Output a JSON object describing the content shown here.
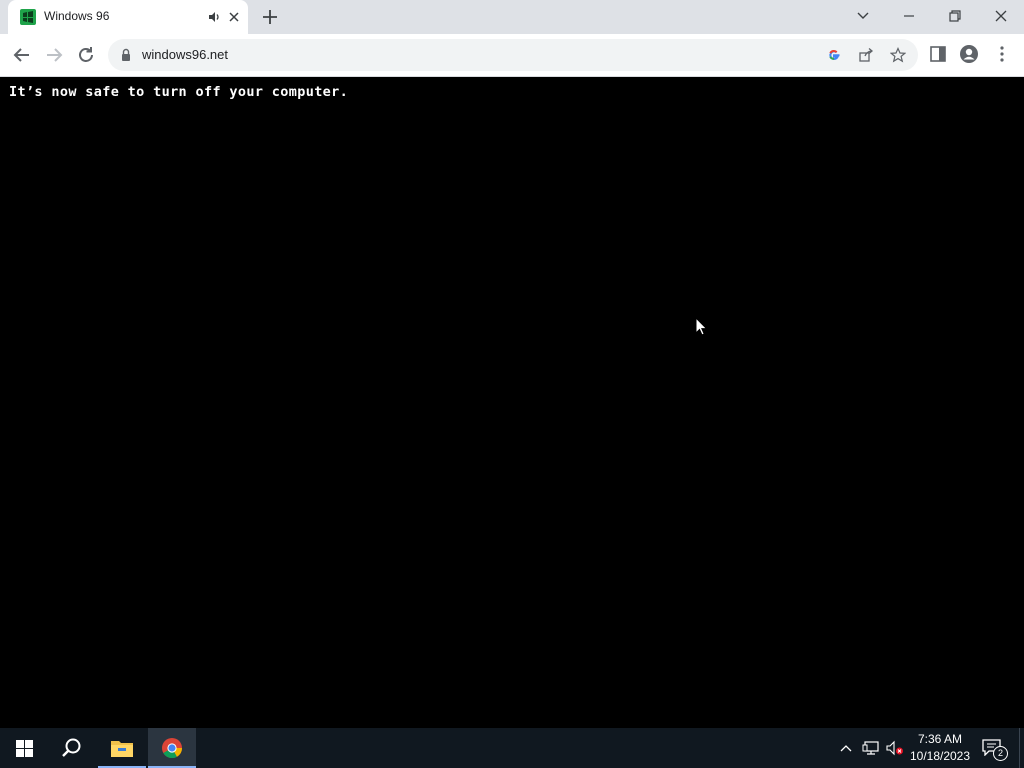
{
  "browser": {
    "tab": {
      "title": "Windows 96"
    },
    "address": {
      "url": "windows96.net"
    }
  },
  "page": {
    "message": "It’s now safe to turn off your computer."
  },
  "taskbar": {
    "time": "7:36 AM",
    "date": "10/18/2023",
    "notification_count": "2"
  },
  "colors": {
    "page_background": "#000000",
    "message_text": "#ffffff",
    "taskbar_background": "#101820",
    "tabstrip_background": "#dee1e6"
  }
}
